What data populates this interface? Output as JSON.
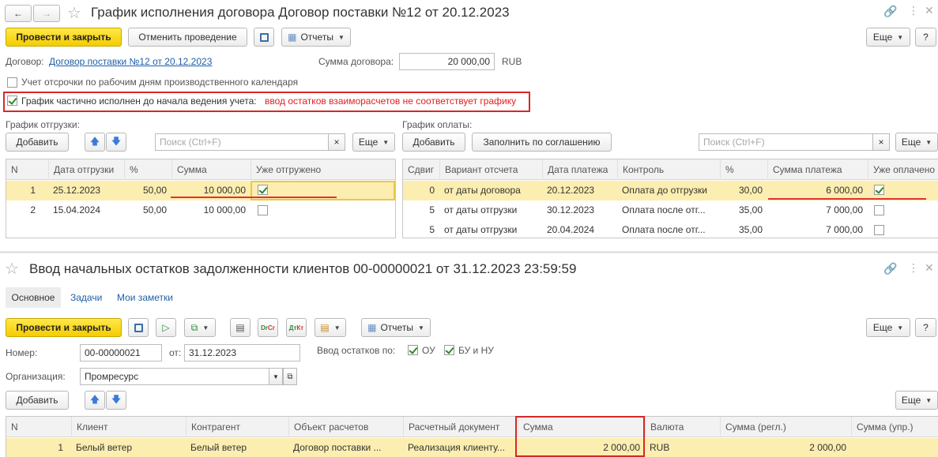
{
  "top": {
    "title": "График исполнения договора Договор поставки №12 от 20.12.2023",
    "post_close": "Провести и закрыть",
    "cancel_post": "Отменить проведение",
    "reports": "Отчеты",
    "more": "Еще",
    "help": "?",
    "contract_label": "Договор:",
    "contract_link": "Договор поставки №12 от 20.12.2023",
    "sum_label": "Сумма договора:",
    "sum_value": "20 000,00",
    "currency": "RUB",
    "deferral_checkbox": "Учет отсрочки по рабочим дням производственного календаря",
    "partial_checkbox": "График частично исполнен до начала ведения учета:",
    "partial_warning": "ввод остатков взаиморасчетов не соответствует графику",
    "shipment": {
      "label": "График отгрузки:",
      "add": "Добавить",
      "search_placeholder": "Поиск (Ctrl+F)",
      "clear": "×",
      "more": "Еще",
      "columns": [
        "N",
        "Дата отгрузки",
        "%",
        "Сумма",
        "Уже отгружено"
      ],
      "rows": [
        {
          "n": "1",
          "date": "25.12.2023",
          "pct": "50,00",
          "sum": "10 000,00",
          "done": true
        },
        {
          "n": "2",
          "date": "15.04.2024",
          "pct": "50,00",
          "sum": "10 000,00",
          "done": false
        }
      ]
    },
    "payment": {
      "label": "График оплаты:",
      "add": "Добавить",
      "fill": "Заполнить по соглашению",
      "search_placeholder": "Поиск (Ctrl+F)",
      "clear": "×",
      "more": "Еще",
      "columns": [
        "Сдвиг",
        "Вариант отсчета",
        "Дата платежа",
        "Контроль",
        "%",
        "Сумма платежа",
        "Уже оплачено"
      ],
      "rows": [
        {
          "shift": "0",
          "variant": "от даты договора",
          "date": "20.12.2023",
          "control": "Оплата до отгрузки",
          "pct": "30,00",
          "sum": "6 000,00",
          "done": true
        },
        {
          "shift": "5",
          "variant": "от даты отгрузки",
          "date": "30.12.2023",
          "control": "Оплата после отг...",
          "pct": "35,00",
          "sum": "7 000,00",
          "done": false
        },
        {
          "shift": "5",
          "variant": "от даты отгрузки",
          "date": "20.04.2024",
          "control": "Оплата после отг...",
          "pct": "35,00",
          "sum": "7 000,00",
          "done": false
        }
      ]
    }
  },
  "bottom": {
    "title": "Ввод начальных остатков задолженности клиентов 00-00000021 от 31.12.2023 23:59:59",
    "tabs": [
      "Основное",
      "Задачи",
      "Мои заметки"
    ],
    "post_close": "Провести и закрыть",
    "reports": "Отчеты",
    "more": "Еще",
    "help": "?",
    "number_label": "Номер:",
    "number_value": "00-00000021",
    "from_label": "от:",
    "date_value": "31.12.2023",
    "input_label": "Ввод остатков по:",
    "ou": "ОУ",
    "bu": "БУ и НУ",
    "org_label": "Организация:",
    "org_value": "Промресурс",
    "add": "Добавить",
    "columns": [
      "N",
      "Клиент",
      "Контрагент",
      "Объект расчетов",
      "Расчетный документ",
      "Сумма",
      "Валюта",
      "Сумма (регл.)",
      "Сумма (упр.)"
    ],
    "rows": [
      {
        "n": "1",
        "client": "Белый ветер",
        "counterparty": "Белый ветер",
        "object": "Договор поставки ...",
        "doc": "Реализация клиенту...",
        "sum": "2 000,00",
        "currency": "RUB",
        "sum_reg": "2 000,00",
        "sum_mgmt": ""
      }
    ]
  }
}
